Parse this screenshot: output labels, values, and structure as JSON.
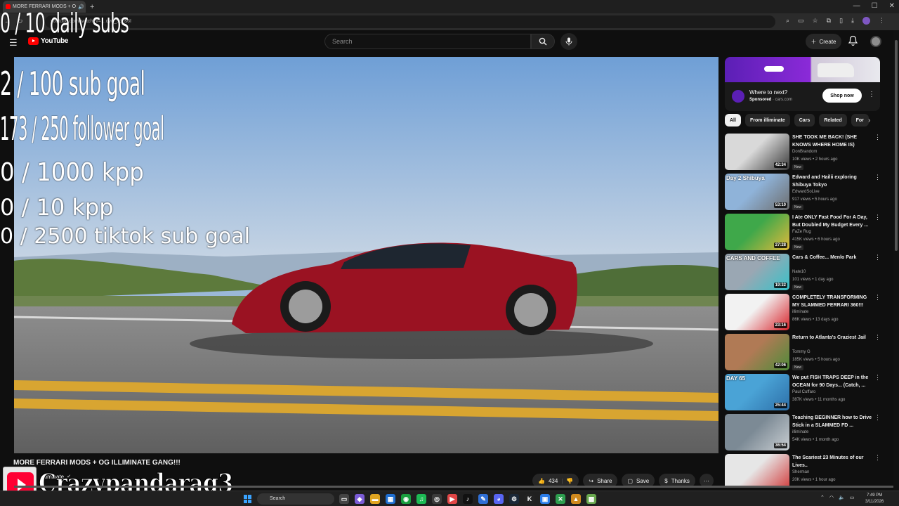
{
  "browser": {
    "tab_title": "MORE FERRARI MODS + O",
    "new_tab": "+",
    "address": "youtube.com/watch?v=…qyd_5dns6I",
    "window_controls": [
      "—",
      "☐",
      "✕"
    ]
  },
  "header": {
    "logo_text": "YouTube",
    "search_placeholder": "Search",
    "create_label": "Create"
  },
  "overlay": {
    "daily_subs": "0 / 10 daily subs",
    "sub_goal": "2  / 100 sub goal",
    "follower_goal": "173 / 250 follower goal",
    "kpp_1000": "0 / 1000 kpp",
    "kpp_10": "0 / 10 kpp",
    "tiktok_goal": "0 / 2500 tiktok sub goal"
  },
  "video": {
    "title": "MORE FERRARI MODS + OG ILLIMINATE GANG!!!",
    "channel": "illiminate"
  },
  "actions": {
    "likes": "434",
    "share": "Share",
    "save": "Save",
    "thanks": "Thanks",
    "more": "⋯"
  },
  "watermark": {
    "text": "Crazypandarag3"
  },
  "ad": {
    "title": "Where to next?",
    "sponsored": "Sponsored",
    "domain": "· cars.com",
    "cta": "Shop now"
  },
  "chips": [
    "All",
    "From illiminate",
    "Cars",
    "Related",
    "For"
  ],
  "recommendations": [
    {
      "title": "SHE TOOK ME BACK! (SHE KNOWS WHERE HOME IS)",
      "channel": "DonBrandom",
      "meta": "10K views • 2 hours ago",
      "badge": "New",
      "duration": "42:34",
      "thumb_label": "",
      "colors": [
        "#d9d9d9",
        "#3a3a3a"
      ]
    },
    {
      "title": "Edward and Hailii exploring Shibuya Tokyo",
      "channel": "EdwardSoLive",
      "meta": "917 views • 5 hours ago",
      "badge": "New",
      "duration": "53:10",
      "thumb_label": "Day 2 Shibuya",
      "colors": [
        "#8fb3d9",
        "#6d6d6d"
      ]
    },
    {
      "title": "I Ate ONLY Fast Food For A Day, But Doubled My Budget Every ...",
      "channel": "FaZe Rug",
      "meta": "415K views • 6 hours ago",
      "badge": "New",
      "duration": "27:28",
      "thumb_label": "",
      "colors": [
        "#3fa84a",
        "#e2b93b"
      ]
    },
    {
      "title": "Cars & Coffee... Menlo Park",
      "channel": "Nate10",
      "meta": "101 views • 1 day ago",
      "badge": "New",
      "duration": "19:32",
      "thumb_label": "CARS AND COFFEE",
      "colors": [
        "#9aa7b3",
        "#37c2c9"
      ]
    },
    {
      "title": "COMPLETELY TRANSFORMING MY SLAMMED FERRARI 360!!!",
      "channel": "illiminate",
      "meta": "86K views • 13 days ago",
      "badge": "",
      "duration": "23:16",
      "thumb_label": "",
      "colors": [
        "#f2f2f2",
        "#d8232a"
      ]
    },
    {
      "title": "Return to Atlanta's Craziest Jail",
      "channel": "Tommy G",
      "meta": "185K views • 5 hours ago",
      "badge": "New",
      "duration": "42:06",
      "thumb_label": "",
      "colors": [
        "#b07a55",
        "#4d8c3a"
      ]
    },
    {
      "title": "We put FISH TRAPS DEEP in the OCEAN for 90 Days... (Catch, ...",
      "channel": "Paul Cuffaro",
      "meta": "387K views • 11 months ago",
      "badge": "",
      "duration": "25:44",
      "thumb_label": "DAY 65",
      "colors": [
        "#4aa3d6",
        "#2d6fa8"
      ]
    },
    {
      "title": "Teaching BEGINNER how to Drive Stick in a SLAMMED FD ...",
      "channel": "illiminate",
      "meta": "54K views • 1 month ago",
      "badge": "",
      "duration": "36:54",
      "thumb_label": "",
      "colors": [
        "#7c8a95",
        "#c9ced2"
      ]
    },
    {
      "title": "The Scariest 23 Minutes of our Lives..",
      "channel": "Sherman",
      "meta": "20K views • 1 hour ago",
      "badge": "",
      "duration": "",
      "thumb_label": "",
      "colors": [
        "#e6e6e6",
        "#d13a3a"
      ]
    }
  ],
  "taskbar": {
    "search": "Search",
    "time": "7:49 PM",
    "date": "3/11/2026"
  }
}
